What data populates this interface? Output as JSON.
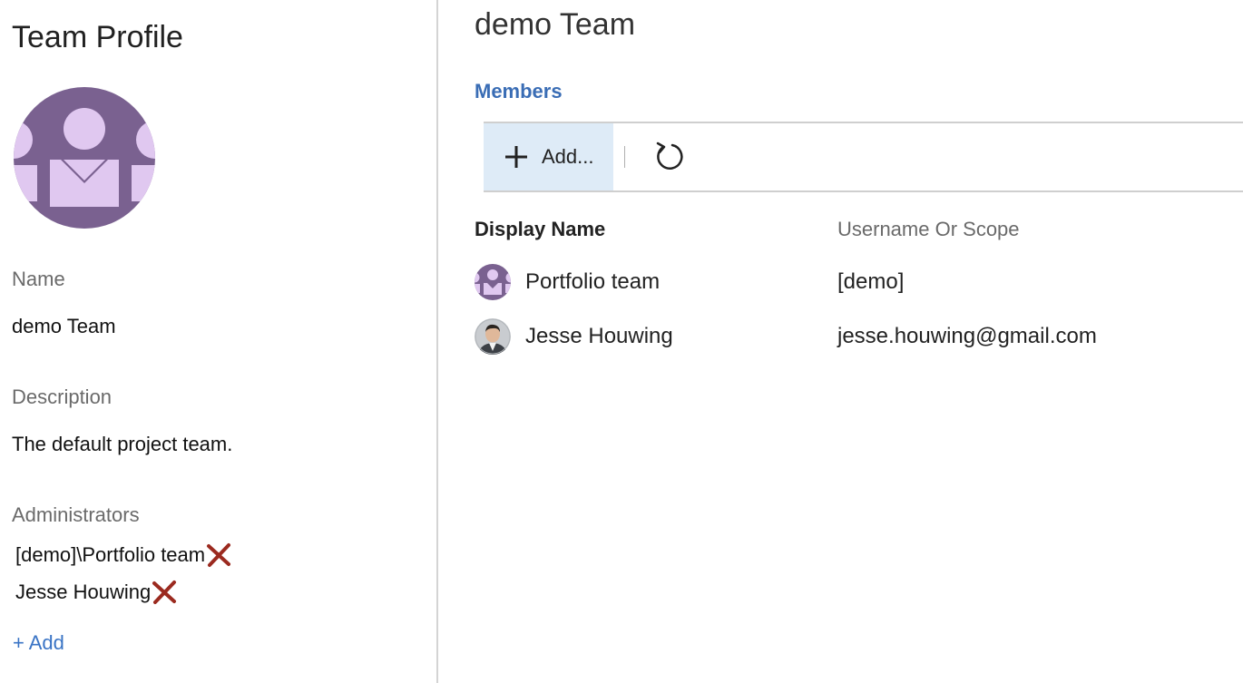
{
  "profile": {
    "title": "Team Profile",
    "avatar_icon": "team-avatar-icon",
    "name_label": "Name",
    "name_value": "demo Team",
    "description_label": "Description",
    "description_value": "The default project team.",
    "administrators_label": "Administrators",
    "administrators": [
      {
        "name": "[demo]\\Portfolio team",
        "remove_icon": "remove-x-icon"
      },
      {
        "name": "Jesse Houwing",
        "remove_icon": "remove-x-icon"
      }
    ],
    "add_admin_label": "+ Add"
  },
  "main": {
    "team_name": "demo Team",
    "members_tab": "Members",
    "toolbar": {
      "add_label": "Add...",
      "add_icon": "plus-icon",
      "refresh_icon": "refresh-icon"
    },
    "columns": {
      "display_name": "Display Name",
      "username": "Username Or Scope"
    },
    "members": [
      {
        "display_name": "Portfolio team",
        "username": "[demo]",
        "avatar": "team-avatar-icon"
      },
      {
        "display_name": "Jesse Houwing",
        "username": "jesse.houwing@gmail.com",
        "avatar": "user-photo-avatar"
      }
    ]
  },
  "colors": {
    "accent": "#3a6db5",
    "link": "#3a74c5",
    "toolbar_button_bg": "#deebf7",
    "avatar_bg": "#7a6190",
    "avatar_fg": "#e0c8f0",
    "remove_x": "#9b2a1f"
  }
}
